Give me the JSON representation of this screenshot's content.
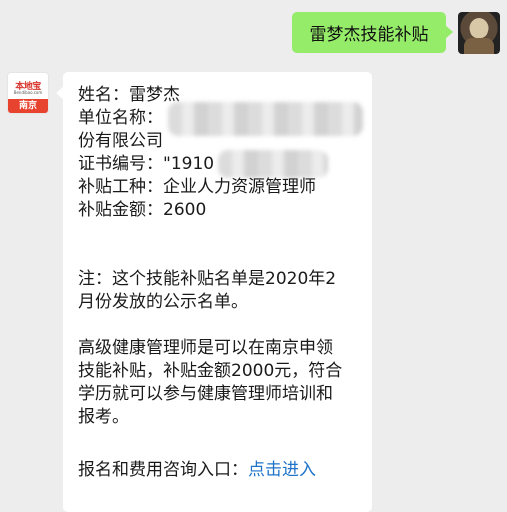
{
  "outgoing": {
    "text": "雷梦杰技能补贴"
  },
  "incoming": {
    "avatar": {
      "brand": "本地宝",
      "site": "Bendibao.com",
      "city": "南京"
    },
    "lines": {
      "name": "姓名：雷梦杰",
      "company_prefix": "单位名称：",
      "company_suffix": "份有限公司",
      "cert": "证书编号：\"1910",
      "type": "补贴工种：企业人力资源管理师",
      "amount": "补贴金额：2600",
      "note1": "注：这个技能补贴名单是2020年2",
      "note2": "月份发放的公示名单。",
      "p1": "高级健康管理师是可以在南京申领",
      "p2": "技能补贴，补贴金额2000元，符合",
      "p3": "学历就可以参与健康管理师培训和",
      "p4": "报考。",
      "link_prefix": "报名和费用咨询入口：",
      "link_text": "点击进入"
    }
  }
}
